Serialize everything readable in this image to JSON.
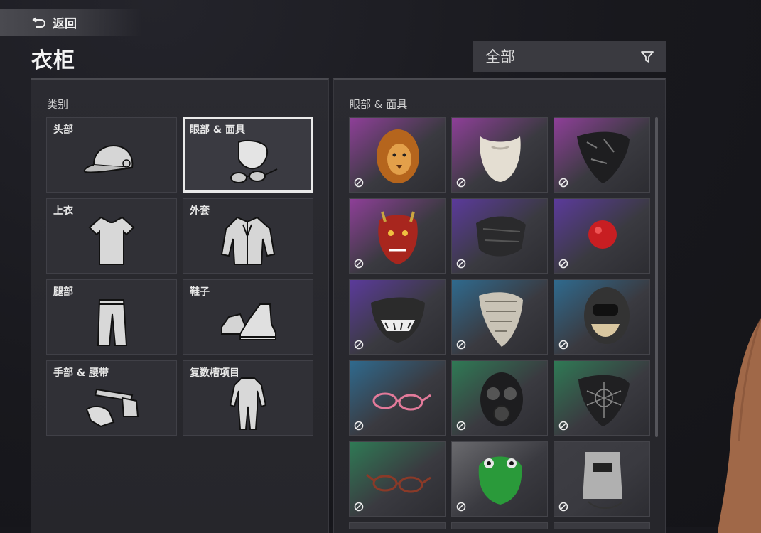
{
  "header": {
    "back_label": "返回",
    "title": "衣柜"
  },
  "filter": {
    "value": "全部"
  },
  "categories_panel": {
    "title": "类别",
    "items": [
      {
        "label": "头部",
        "icon": "cap-icon",
        "selected": false
      },
      {
        "label": "眼部 & 面具",
        "icon": "mask-glasses-icon",
        "selected": true
      },
      {
        "label": "上衣",
        "icon": "tshirt-icon",
        "selected": false
      },
      {
        "label": "外套",
        "icon": "jacket-icon",
        "selected": false
      },
      {
        "label": "腿部",
        "icon": "pants-icon",
        "selected": false
      },
      {
        "label": "鞋子",
        "icon": "shoes-icon",
        "selected": false
      },
      {
        "label": "手部 & 腰带",
        "icon": "gloves-belt-icon",
        "selected": false
      },
      {
        "label": "复数槽项目",
        "icon": "jumpsuit-icon",
        "selected": false
      }
    ]
  },
  "items_panel": {
    "title": "眼部 & 面具",
    "items": [
      {
        "name": "lion-mask",
        "bg": "#8e3f98"
      },
      {
        "name": "white-beard",
        "bg": "#8e3f98"
      },
      {
        "name": "black-bandana",
        "bg": "#8e3f98"
      },
      {
        "name": "red-oni-mask",
        "bg": "#8e3f98"
      },
      {
        "name": "dark-face-mask",
        "bg": "#5b3a9b"
      },
      {
        "name": "red-clown-nose",
        "bg": "#5b3a9b"
      },
      {
        "name": "tiger-face-mask",
        "bg": "#5b3a9b"
      },
      {
        "name": "shemagh-scarf",
        "bg": "#2f6a8e"
      },
      {
        "name": "balaclava-skull",
        "bg": "#2f6a8e"
      },
      {
        "name": "pink-glasses",
        "bg": "#2f6a8e"
      },
      {
        "name": "gas-mask",
        "bg": "#2f7a55"
      },
      {
        "name": "spider-web-bandana",
        "bg": "#2f7a55"
      },
      {
        "name": "brown-glasses",
        "bg": "#2f7a55"
      },
      {
        "name": "green-crocodile-mask",
        "bg": "#6a6a6e"
      },
      {
        "name": "welding-helmet",
        "bg": "#3e3e44"
      }
    ]
  }
}
